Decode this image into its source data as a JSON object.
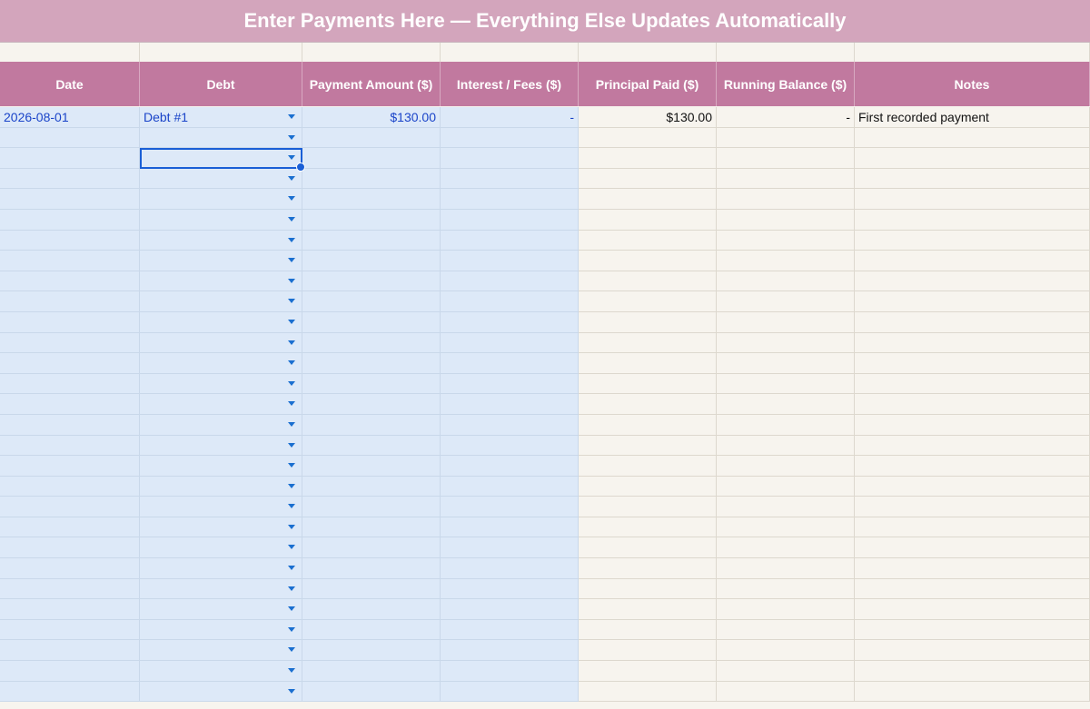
{
  "banner": {
    "title": "Enter Payments Here — Everything Else Updates Automatically"
  },
  "columns": [
    "Date",
    "Debt",
    "Payment Amount ($)",
    "Interest / Fees ($)",
    "Principal Paid ($)",
    "Running Balance ($)",
    "Notes"
  ],
  "rows": [
    {
      "date": "2026-08-01",
      "debt": "Debt #1",
      "payment": "$130.00",
      "interest": "-",
      "principal": "$130.00",
      "balance": "-",
      "notes": "First recorded payment"
    }
  ],
  "selected_cell": {
    "row": 3,
    "column": "Debt"
  },
  "colors": {
    "banner": "#d3a5bc",
    "header": "#c1799f",
    "input_area": "#dde9f8",
    "computed_area": "#f7f4ee",
    "input_text": "#1a44c9",
    "selection": "#1a5fd6"
  },
  "icons": {
    "dropdown": "dropdown-arrow-icon"
  }
}
